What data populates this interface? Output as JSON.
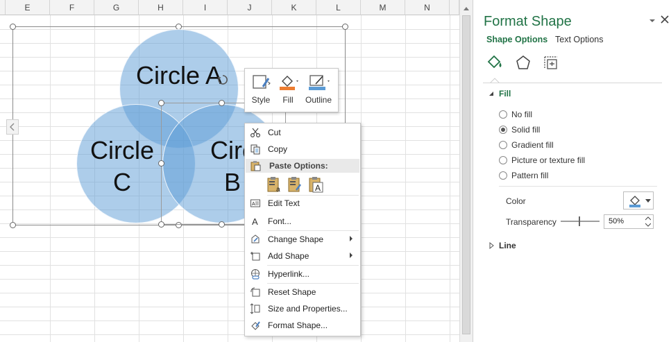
{
  "sheet": {
    "columns": [
      "E",
      "F",
      "G",
      "H",
      "I",
      "J",
      "K",
      "L",
      "M",
      "N"
    ],
    "shapes": {
      "circle_a": "Circle A",
      "circle_b": "Circ\nB",
      "circle_c": "Circle\nC"
    },
    "fill_color": "#5b9bd5"
  },
  "mini_toolbar": {
    "style_label": "Style",
    "fill_label": "Fill",
    "outline_label": "Outline"
  },
  "context_menu": {
    "cut": "Cut",
    "copy": "Copy",
    "paste_options": "Paste Options:",
    "edit_text": "Edit Text",
    "font": "Font...",
    "change_shape": "Change Shape",
    "add_shape": "Add Shape",
    "hyperlink": "Hyperlink...",
    "reset_shape": "Reset Shape",
    "size_properties": "Size and Properties...",
    "format_shape": "Format Shape..."
  },
  "pane": {
    "title": "Format Shape",
    "tab_shape_options": "Shape Options",
    "tab_text_options": "Text Options",
    "fill_section": "Fill",
    "options": [
      "No fill",
      "Solid fill",
      "Gradient fill",
      "Picture or texture fill",
      "Pattern fill"
    ],
    "selected_option": "Solid fill",
    "color_label": "Color",
    "transparency_label": "Transparency",
    "transparency_value": "50%",
    "line_section": "Line",
    "accent_color": "#217346"
  }
}
